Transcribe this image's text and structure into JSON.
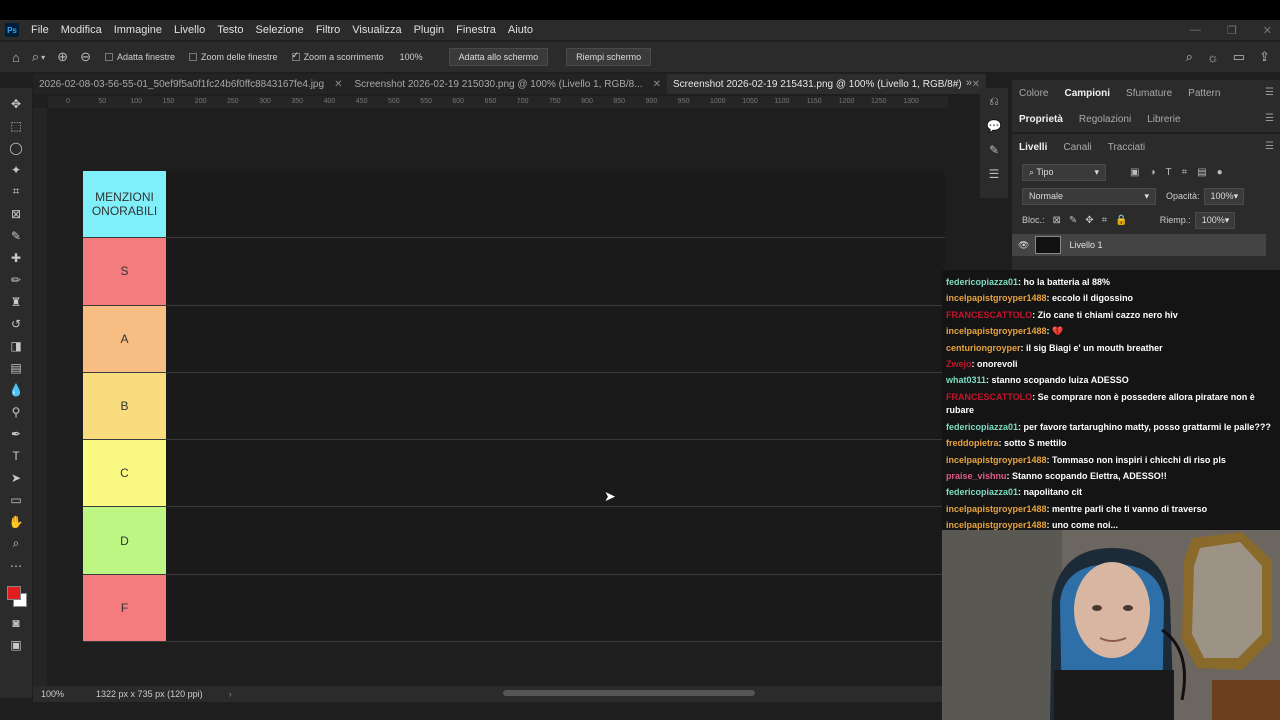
{
  "menu": [
    "File",
    "Modifica",
    "Immagine",
    "Livello",
    "Testo",
    "Selezione",
    "Filtro",
    "Visualizza",
    "Plugin",
    "Finestra",
    "Aiuto"
  ],
  "options": {
    "adatta_finestre": "Adatta finestre",
    "zoom_finestre": "Zoom delle finestre",
    "zoom_scorrimento": "Zoom a scorrimento",
    "zoom_value": "100%",
    "fit_screen": "Adatta allo schermo",
    "fill_screen": "Riempi schermo"
  },
  "tabs": [
    {
      "label": "2026-02-08-03-56-55-01_50ef9f5a0f1fc24b6f0ffc8843167fe4.jpg",
      "active": false
    },
    {
      "label": "Screenshot 2026-02-19 215030.png @ 100% (Livello 1, RGB/8...",
      "active": false
    },
    {
      "label": "Screenshot 2026-02-19 215431.png @ 100% (Livello 1, RGB/8#)",
      "active": true
    }
  ],
  "ruler_ticks": [
    "0",
    "50",
    "100",
    "150",
    "200",
    "250",
    "300",
    "350",
    "400",
    "450",
    "500",
    "550",
    "600",
    "650",
    "700",
    "750",
    "800",
    "850",
    "900",
    "950",
    "1000",
    "1050",
    "1100",
    "1150",
    "1200",
    "1250",
    "1300"
  ],
  "tiers": [
    {
      "label": "MENZIONI ONORABILI",
      "color": "#7ff0f9"
    },
    {
      "label": "S",
      "color": "#f47b7e"
    },
    {
      "label": "A",
      "color": "#f8bd83"
    },
    {
      "label": "B",
      "color": "#f9dc7e"
    },
    {
      "label": "C",
      "color": "#faf981"
    },
    {
      "label": "D",
      "color": "#bdf682"
    },
    {
      "label": "F",
      "color": "#f47b7e"
    }
  ],
  "status": {
    "zoom": "100%",
    "doc_info": "1322 px x 735 px (120 ppi)"
  },
  "panels": {
    "tabs1": [
      "Colore",
      "Campioni",
      "Sfumature",
      "Pattern"
    ],
    "tabs1_active": "Campioni",
    "tabs2": [
      "Proprietà",
      "Regolazioni",
      "Librerie"
    ],
    "tabs2_active": "Proprietà",
    "tabs3": [
      "Livelli",
      "Canali",
      "Tracciati"
    ],
    "tabs3_active": "Livelli",
    "filter_kind": "Tipo",
    "blend_mode": "Normale",
    "opacity_label": "Opacità:",
    "opacity": "100%",
    "lock_label": "Bloc.:",
    "fill_label": "Riemp.:",
    "fill": "100%",
    "layer_name": "Livello 1"
  },
  "chat": [
    {
      "user": "federicopiazza01",
      "color": "#7fdbc1",
      "text": ": ho la batteria al 88%"
    },
    {
      "user": "incelpapistgroyper1488",
      "color": "#e8a33d",
      "text": ": eccolo il digossino"
    },
    {
      "user": "FRANCESCATTOLO",
      "color": "#c0162c",
      "text": ": Zio cane ti chiami cazzo nero hiv"
    },
    {
      "user": "incelpapistgroyper1488",
      "color": "#e8a33d",
      "text": ": 💔"
    },
    {
      "user": "centuriongroyper",
      "color": "#e8a33d",
      "text": ": il sig Biagi e' un mouth breather"
    },
    {
      "user": "Zwejo",
      "color": "#c0162c",
      "text": ": onorevoli"
    },
    {
      "user": "what0311",
      "color": "#7fdbc1",
      "text": ": stanno scopando luiza ADESSO"
    },
    {
      "user": "FRANCESCATTOLO",
      "color": "#c0162c",
      "text": ": Se comprare non è possedere allora piratare non è rubare",
      "wrap": true
    },
    {
      "user": "federicopiazza01",
      "color": "#7fdbc1",
      "text": ": per favore tartarughino matty, posso grattarmi le palle???"
    },
    {
      "user": "freddopietra",
      "color": "#e8a33d",
      "text": ": sotto S mettilo"
    },
    {
      "user": "incelpapistgroyper1488",
      "color": "#e8a33d",
      "text": ": Tommaso non inspiri i chicchi di riso pls"
    },
    {
      "user": "praise_vishnu",
      "color": "#e05a8a",
      "text": ": Stanno scopando Elettra, ADESSO!!"
    },
    {
      "user": "federicopiazza01",
      "color": "#7fdbc1",
      "text": ": napolitano cit"
    },
    {
      "user": "incelpapistgroyper1488",
      "color": "#e8a33d",
      "text": ": mentre parli che ti vanno di traverso"
    },
    {
      "user": "incelpapistgroyper1488",
      "color": "#e8a33d",
      "text": ": uno come noi..."
    }
  ]
}
